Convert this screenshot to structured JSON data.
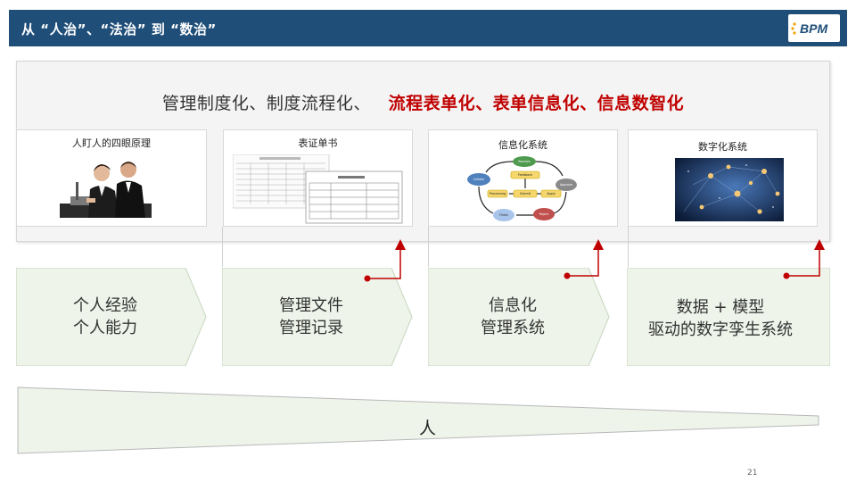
{
  "header": {
    "title": "从 “人治”、“法治” 到 “数治”",
    "logo": "BPM",
    "bg_color": "#1f4e79"
  },
  "slogan": {
    "normal": "管理制度化、制度流程化、",
    "highlight": "流程表单化、表单信息化、信息数智化",
    "highlight_color": "#c00000"
  },
  "cards": [
    {
      "label": "人盯人的四眼原理",
      "image": "people-at-computer"
    },
    {
      "label": "表证单书",
      "image": "paper-forms"
    },
    {
      "label": "信息化系统",
      "image": "cycle-diagram"
    },
    {
      "label": "数字化系统",
      "image": "digital-network"
    }
  ],
  "diagram": {
    "nodes": [
      "Initiate",
      "Feedback",
      "Receive",
      "Apply",
      "Processing",
      "Submit",
      "Reject",
      "Approve",
      "Finish"
    ]
  },
  "stages": [
    {
      "line1": "个人经验",
      "line2": "个人能力"
    },
    {
      "line1": "管理文件",
      "line2": "管理记录"
    },
    {
      "line1": "信息化",
      "line2": "管理系统"
    },
    {
      "line1": "数据 + 模型",
      "line2": "驱动的数字孪生系统"
    }
  ],
  "triangle_label": "人",
  "page_number": "21",
  "colors": {
    "stage_fill": "#eef4ea",
    "arrow_red": "#c00000"
  }
}
